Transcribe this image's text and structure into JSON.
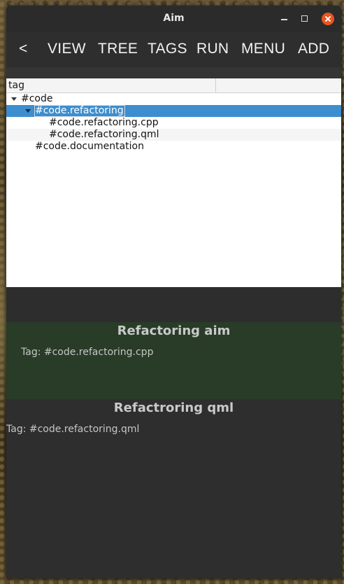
{
  "window": {
    "title": "Aim"
  },
  "toolbar": {
    "back": "<",
    "view": "VIEW",
    "tree": "TREE",
    "tags": "TAGS",
    "run": "RUN",
    "menu": "MENU",
    "add": "ADD"
  },
  "tree": {
    "header": {
      "col1": "tag",
      "col2": ""
    },
    "rows": [
      {
        "label": "#code",
        "expanded": true,
        "selected": false
      },
      {
        "label": "#code.refactoring",
        "expanded": true,
        "selected": true
      },
      {
        "label": "#code.refactoring.cpp",
        "selected": false
      },
      {
        "label": "#code.refactoring.qml",
        "selected": false
      },
      {
        "label": "#code.documentation",
        "selected": false
      }
    ]
  },
  "panels": [
    {
      "title": "Refactoring aim",
      "tag_text": "Tag: #code.refactoring.cpp",
      "bg": "#283c28"
    },
    {
      "title": "Refactroring qml",
      "tag_text": "Tag: #code.refactoring.qml",
      "bg": "#2e2e2e"
    }
  ],
  "colors": {
    "selection": "#3c8ecf",
    "close_button": "#e9541f"
  }
}
